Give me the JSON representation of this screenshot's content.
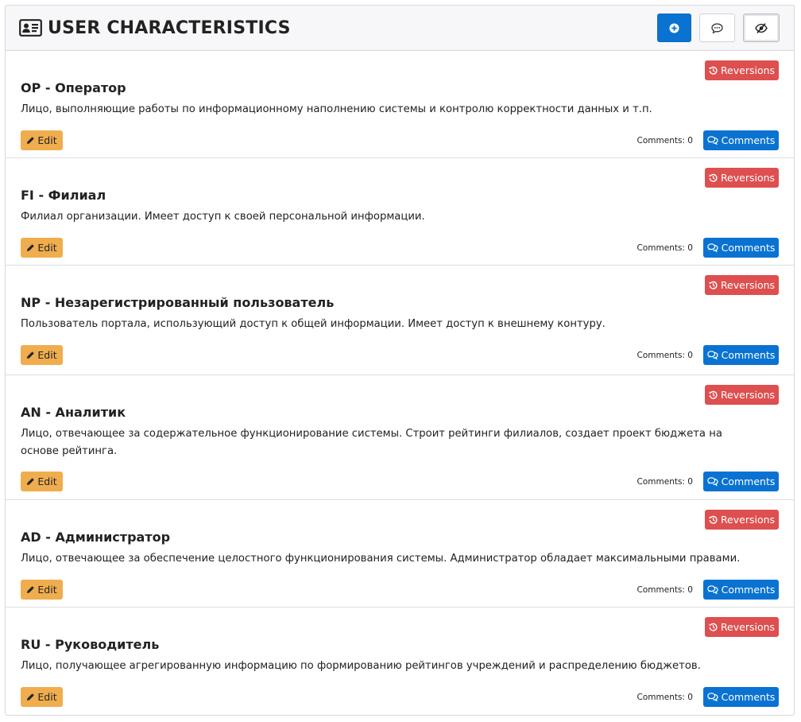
{
  "header": {
    "title": "USER CHARACTERISTICS",
    "icon": "id-card-icon",
    "actions": [
      {
        "name": "add-button",
        "icon": "plus-circle-icon",
        "color": "#0a73d1"
      },
      {
        "name": "comments-toggle-button",
        "icon": "comment-icon"
      },
      {
        "name": "hide-button",
        "icon": "eye-slash-icon"
      }
    ]
  },
  "labels": {
    "reversions": "Reversions",
    "edit": "Edit",
    "comments": "Comments"
  },
  "colors": {
    "primary": "#0a73d1",
    "danger": "#de4f4f",
    "warning": "#f0ad4e"
  },
  "items": [
    {
      "title": "OP - Оператор",
      "description": "Лицо, выполняющие работы по информационному наполнению системы и контролю корректности данных и т.п.",
      "comments_text": "Comments: 0"
    },
    {
      "title": "FI - Филиал",
      "description": "Филиал организации. Имеет доступ к своей персональной информации.",
      "comments_text": "Comments: 0"
    },
    {
      "title": "NP - Незарегистрированный пользователь",
      "description": "Пользователь портала, использующий доступ к общей информации. Имеет доступ к внешнему контуру.",
      "comments_text": "Comments: 0"
    },
    {
      "title": "AN - Аналитик",
      "description": "Лицо, отвечающее за содержательное функционирование системы. Строит рейтинги филиалов, создает проект бюджета на основе рейтинга.",
      "comments_text": "Comments: 0"
    },
    {
      "title": "AD - Администратор",
      "description": "Лицо, отвечающее за обеспечение целостного функционирования системы. Администратор обладает максимальными правами.",
      "comments_text": "Comments: 0"
    },
    {
      "title": "RU - Руководитель",
      "description": "Лицо, получающее агрегированную информацию по формированию рейтингов учреждений и распределению бюджетов.",
      "comments_text": "Comments: 0"
    }
  ]
}
